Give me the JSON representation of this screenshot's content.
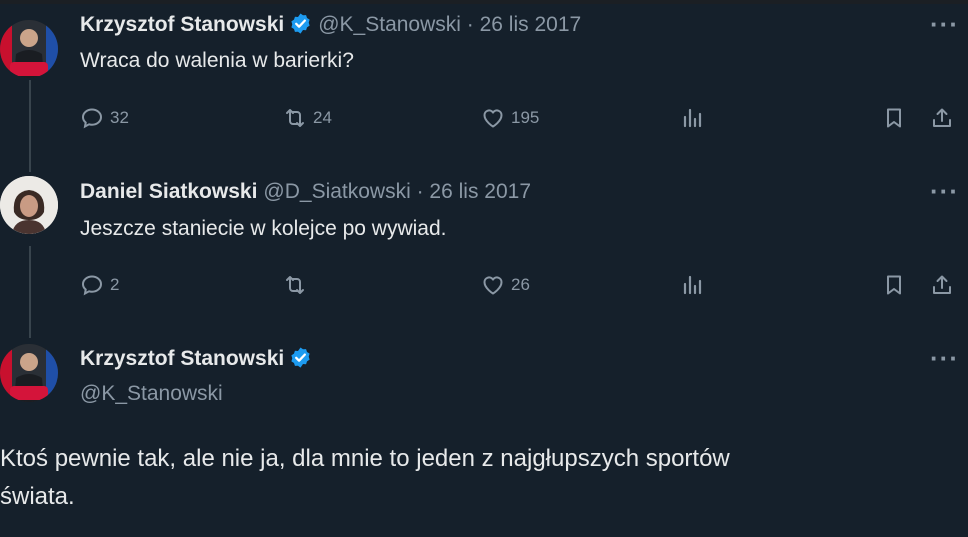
{
  "tweets": [
    {
      "name": "Krzysztof Stanowski",
      "handle": "@K_Stanowski",
      "date": "· 26 lis 2017",
      "text": "Wraca do walenia w barierki?",
      "replies": "32",
      "retweets": "24",
      "likes": "195",
      "more": "···"
    },
    {
      "name": "Daniel Siatkowski",
      "handle": "@D_Siatkowski",
      "date": "· 26 lis 2017",
      "text": "Jeszcze staniecie w kolejce po wywiad.",
      "replies": "2",
      "retweets": "",
      "likes": "26",
      "more": "···"
    }
  ],
  "main_tweet": {
    "name": "Krzysztof Stanowski",
    "handle": "@K_Stanowski",
    "text_line1": "Ktoś pewnie tak, ale nie ja, dla mnie to jeden z najgłupszych sportów",
    "text_line2": "świata.",
    "more": "···"
  },
  "colors": {
    "background": "#15202b",
    "text": "#e7e9ea",
    "muted": "#8b98a5",
    "verified": "#1d9bf0"
  },
  "icons": [
    "reply-icon",
    "retweet-icon",
    "like-icon",
    "views-icon",
    "bookmark-icon",
    "share-icon",
    "verified-badge-icon",
    "more-icon"
  ]
}
